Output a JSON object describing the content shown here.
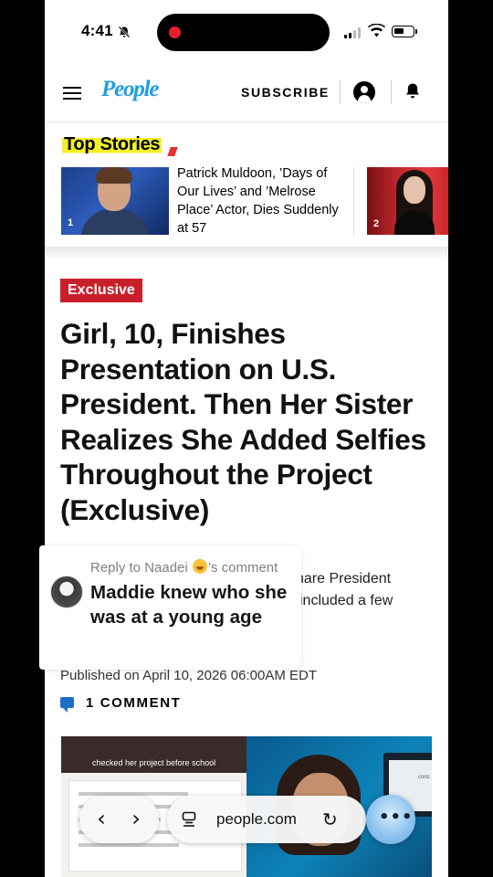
{
  "status_bar": {
    "time": "4:41"
  },
  "header": {
    "logo": "People",
    "subscribe_label": "SUBSCRIBE"
  },
  "top_stories": {
    "title": "Top Stories",
    "items": [
      {
        "number": "1",
        "headline": "Patrick Muldoon, ’Days of Our Lives’ and ’Melrose Place’ Actor, Dies Suddenly at 57"
      },
      {
        "number": "2",
        "headline": ""
      }
    ]
  },
  "article": {
    "badge": "Exclusive",
    "headline": "Girl, 10, Finishes Presentation on U.S. President. Then Her Sister Realizes She Added Selfies Throughout the Project (Exclusive)",
    "dek_line1": "hare President",
    "dek_line2": "included a few",
    "published": "Published on April 10, 2026 06:00AM EDT",
    "comments_label": "1 COMMENT"
  },
  "media": {
    "caption": "checked her project before school",
    "screen_text": "conc"
  },
  "browser": {
    "url": "people.com"
  },
  "comment_overlay": {
    "reply_prefix": "Reply to Naadei",
    "reply_suffix": "’s comment",
    "text": "Maddie knew who she was at a young age"
  }
}
